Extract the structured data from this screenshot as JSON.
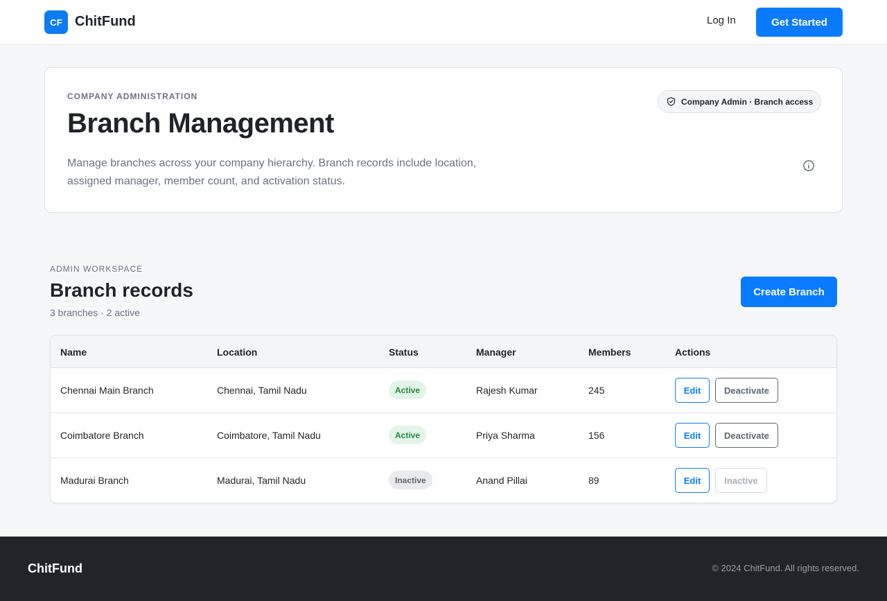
{
  "header": {
    "logo_text": "CF",
    "brand": "ChitFund",
    "login_label": "Log In",
    "get_started_label": "Get Started"
  },
  "hero": {
    "eyebrow": "COMPANY ADMINISTRATION",
    "title": "Branch Management",
    "description": "Manage branches across your company hierarchy. Branch records include location, assigned manager, member count, and activation status.",
    "role_badge": "Company Admin · Branch access",
    "role_icon": "shield-check-icon",
    "info_icon": "info-icon"
  },
  "workspace": {
    "eyebrow": "ADMIN WORKSPACE",
    "title": "Branch records",
    "meta": "3 branches · 2 active",
    "create_label": "Create Branch"
  },
  "table": {
    "columns": [
      "Name",
      "Location",
      "Status",
      "Manager",
      "Members",
      "Actions"
    ],
    "rows": [
      {
        "name": "Chennai Main Branch",
        "location": "Chennai, Tamil Nadu",
        "status": "Active",
        "manager": "Rajesh Kumar",
        "members": "245",
        "edit": "Edit",
        "toggle": "Deactivate"
      },
      {
        "name": "Coimbatore Branch",
        "location": "Coimbatore, Tamil Nadu",
        "status": "Active",
        "manager": "Priya Sharma",
        "members": "156",
        "edit": "Edit",
        "toggle": "Deactivate"
      },
      {
        "name": "Madurai Branch",
        "location": "Madurai, Tamil Nadu",
        "status": "Inactive",
        "manager": "Anand Pillai",
        "members": "89",
        "edit": "Edit",
        "toggle": "Inactive"
      }
    ]
  },
  "footer": {
    "brand": "ChitFund",
    "copyright": "© 2024 ChitFund. All rights reserved."
  },
  "colors": {
    "primary": "#0a7bff",
    "active_bg": "#e3f5e8",
    "active_text": "#1f8a3e",
    "footer_bg": "#212429"
  }
}
